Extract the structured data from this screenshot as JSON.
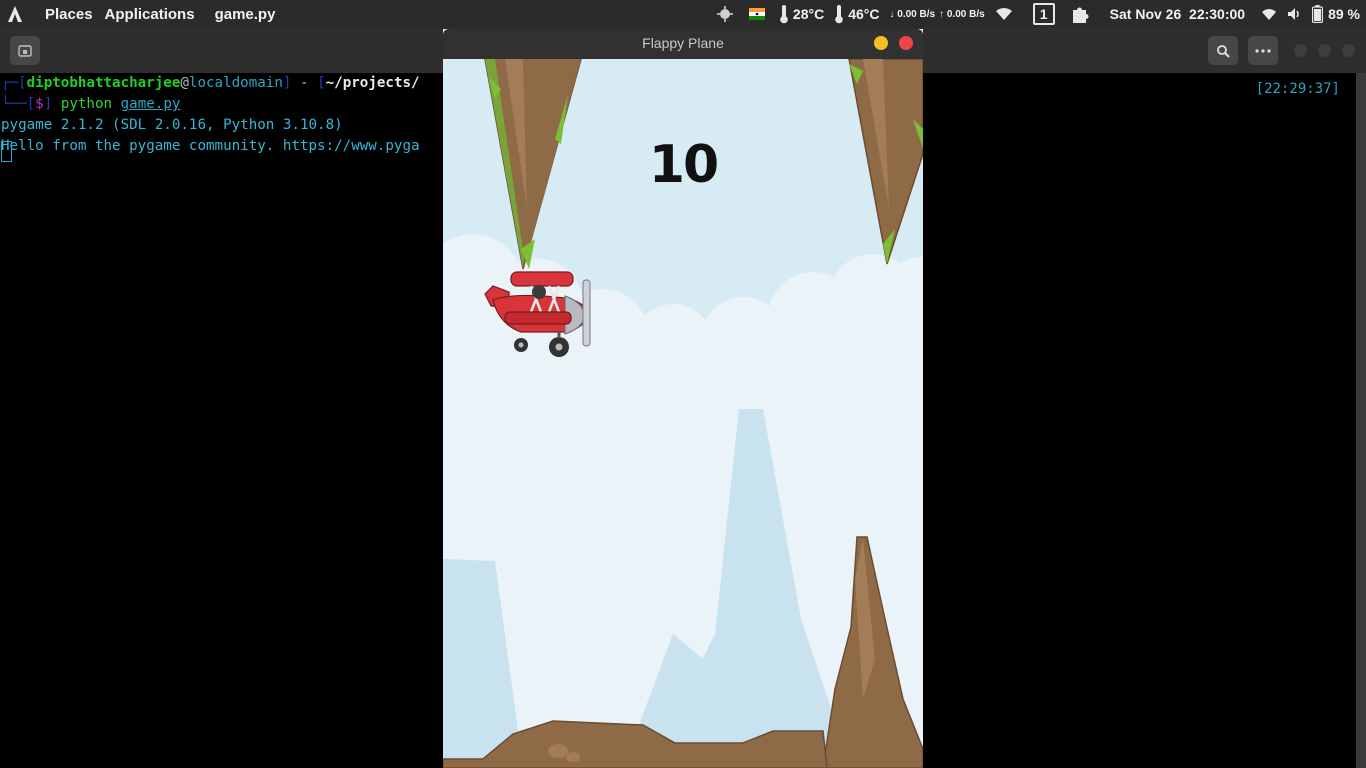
{
  "top_panel": {
    "places_label": "Places",
    "applications_label": "Applications",
    "active_app": "game.py",
    "cpu_temp": "28°C",
    "gpu_temp": "46°C",
    "net_down": "↓ 0.00 B/s",
    "net_up": "↑ 0.00 B/s",
    "workspace_number": "1",
    "datetime": "Sat Nov 26  22:30:00",
    "battery": "89 %",
    "icons": [
      "distro-logo-icon",
      "sun-icon",
      "india-flag-icon",
      "thermometer-icon",
      "wifi-icon",
      "puzzle-extension-icon",
      "volume-icon",
      "battery-icon"
    ]
  },
  "terminal": {
    "prompt": {
      "user": "diptobhattacharjee",
      "at": "@",
      "host": "localdomain",
      "separator": " - ",
      "path": "~/projects/",
      "dollar": "$",
      "command": "python",
      "argument": "game.py"
    },
    "output_line_1": "pygame 2.1.2 (SDL 2.0.16, Python 3.10.8)",
    "output_line_2": "Hello from the pygame community. https://www.pyga",
    "clock": "[22:29:37]"
  },
  "game": {
    "window_title": "Flappy Plane",
    "score": "10",
    "colors": {
      "sky": "#d7ebf4",
      "cloud": "#eaf4f9",
      "mountain": "#c7e1ee",
      "rock": "#8b6544",
      "grass": "#7cbf37",
      "plane": "#d8343a"
    }
  }
}
